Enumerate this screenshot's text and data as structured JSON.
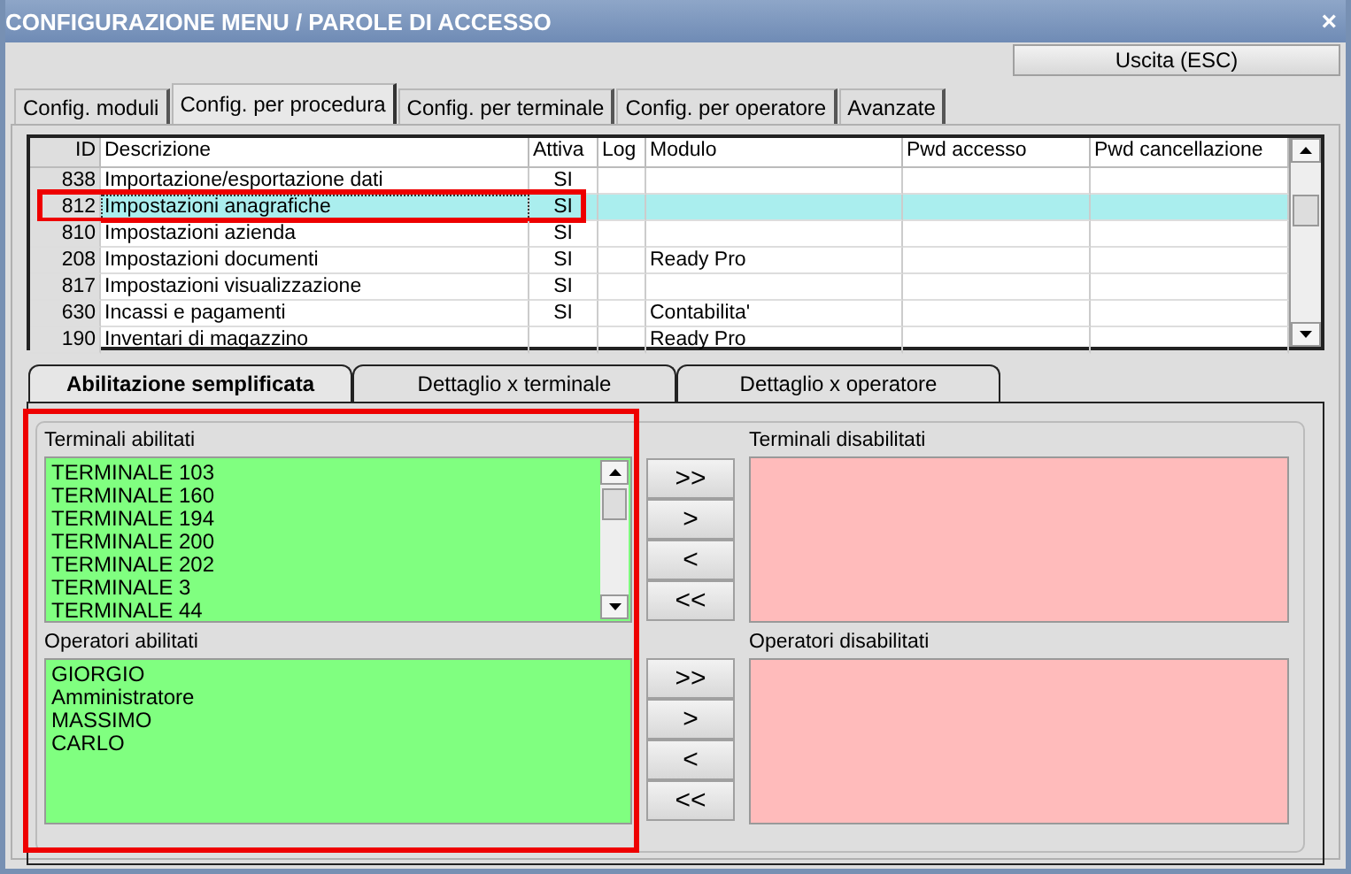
{
  "window": {
    "title": "CONFIGURAZIONE MENU / PAROLE DI ACCESSO",
    "close": "×"
  },
  "exit_button": "Uscita (ESC)",
  "tabs": [
    {
      "label": "Config. moduli",
      "selected": false
    },
    {
      "label": "Config. per procedura",
      "selected": true
    },
    {
      "label": "Config. per terminale",
      "selected": false
    },
    {
      "label": "Config. per operatore",
      "selected": false
    },
    {
      "label": "Avanzate",
      "selected": false
    }
  ],
  "table": {
    "columns": [
      "ID",
      "Descrizione",
      "Attiva",
      "Log",
      "Modulo",
      "Pwd accesso",
      "Pwd cancellazione"
    ],
    "rows": [
      {
        "cells": [
          "838",
          "Importazione/esportazione dati",
          "SI",
          "",
          "",
          "",
          ""
        ],
        "selected": false,
        "annotated": false
      },
      {
        "cells": [
          "812",
          "Impostazioni anagrafiche",
          "SI",
          "",
          "",
          "",
          ""
        ],
        "selected": true,
        "annotated": true
      },
      {
        "cells": [
          "810",
          "Impostazioni azienda",
          "SI",
          "",
          "",
          "",
          ""
        ],
        "selected": false,
        "annotated": false
      },
      {
        "cells": [
          "208",
          "Impostazioni documenti",
          "SI",
          "",
          "Ready Pro",
          "",
          ""
        ],
        "selected": false,
        "annotated": false
      },
      {
        "cells": [
          "817",
          "Impostazioni visualizzazione",
          "SI",
          "",
          "",
          "",
          ""
        ],
        "selected": false,
        "annotated": false
      },
      {
        "cells": [
          "630",
          "Incassi e pagamenti",
          "SI",
          "",
          "Contabilita'",
          "",
          ""
        ],
        "selected": false,
        "annotated": false
      },
      {
        "cells": [
          "190",
          "Inventari di magazzino",
          "",
          "",
          "Ready Pro",
          "",
          ""
        ],
        "selected": false,
        "annotated": false
      }
    ]
  },
  "sub_tabs": [
    {
      "label": "Abilitazione semplificata",
      "selected": true
    },
    {
      "label": "Dettaglio x terminale",
      "selected": false
    },
    {
      "label": "Dettaglio x operatore",
      "selected": false
    }
  ],
  "enabled_group": {
    "annotated": true,
    "sections": [
      {
        "label": "Terminali abilitati",
        "items": [
          "TERMINALE 103",
          "TERMINALE 160",
          "TERMINALE 194",
          "TERMINALE 200",
          "TERMINALE 202",
          "TERMINALE 3",
          "TERMINALE 44"
        ],
        "scrollbar": true
      },
      {
        "label": "Operatori abilitati",
        "items": [
          "GIORGIO",
          "Amministratore",
          "MASSIMO",
          "CARLO"
        ],
        "scrollbar": false
      }
    ]
  },
  "move_buttons": [
    [
      ">>",
      ">",
      "<",
      "<<"
    ],
    [
      ">>",
      ">",
      "<",
      "<<"
    ]
  ],
  "disabled_sections": [
    {
      "label": "Terminali disabilitati"
    },
    {
      "label": "Operatori disabilitati"
    }
  ]
}
